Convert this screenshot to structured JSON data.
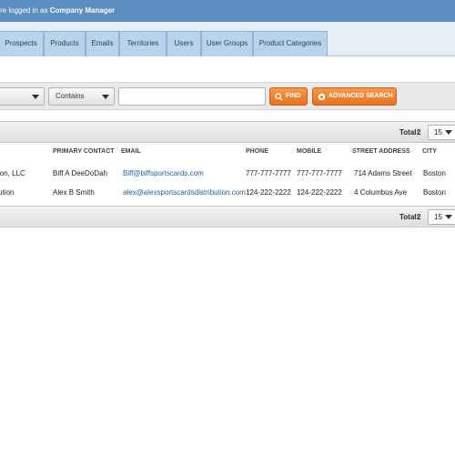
{
  "header": {
    "login_prefix": "re logged in as ",
    "user_role": "Company Manager"
  },
  "nav": {
    "tabs": [
      {
        "label": "Prospects"
      },
      {
        "label": "Products"
      },
      {
        "label": "Emails"
      },
      {
        "label": "Territories"
      },
      {
        "label": "Users"
      },
      {
        "label": "User Groups"
      },
      {
        "label": "Product Categories"
      }
    ]
  },
  "filter": {
    "field_value": "",
    "operator_value": "Contains",
    "search_value": "",
    "find_label": "FIND",
    "advanced_label": "ADVANCED SEARCH"
  },
  "grid": {
    "total_label": "Total:",
    "total_value": "2",
    "page_size": "15",
    "columns": [
      "PRIMARY CONTACT",
      "EMAIL",
      "PHONE",
      "MOBILE",
      "STREET ADDRESS",
      "CITY"
    ],
    "rows": [
      {
        "name": "ion, LLC",
        "contact": "Biff A DeeDoDah",
        "email": "Biff@biffsportscards.com",
        "phone": "777-777-7777",
        "mobile": "777-777-7777",
        "street": "714 Adams Street",
        "city": "Boston"
      },
      {
        "name": "ution",
        "contact": "Alex B Smith",
        "email": "alex@alexsportscardsdistribution.com",
        "phone": "124-222-2222",
        "mobile": "124-222-2222",
        "street": "4 Columbus Ave",
        "city": "Boston"
      }
    ]
  },
  "colors": {
    "topbar": "#5b8fbf",
    "tab": "#b9d3ea",
    "button_orange": "#e6721f",
    "link": "#1f5f9c"
  },
  "icons": {
    "find": "search-icon",
    "advanced": "gear-icon",
    "dropdown": "chevron-down-icon"
  }
}
